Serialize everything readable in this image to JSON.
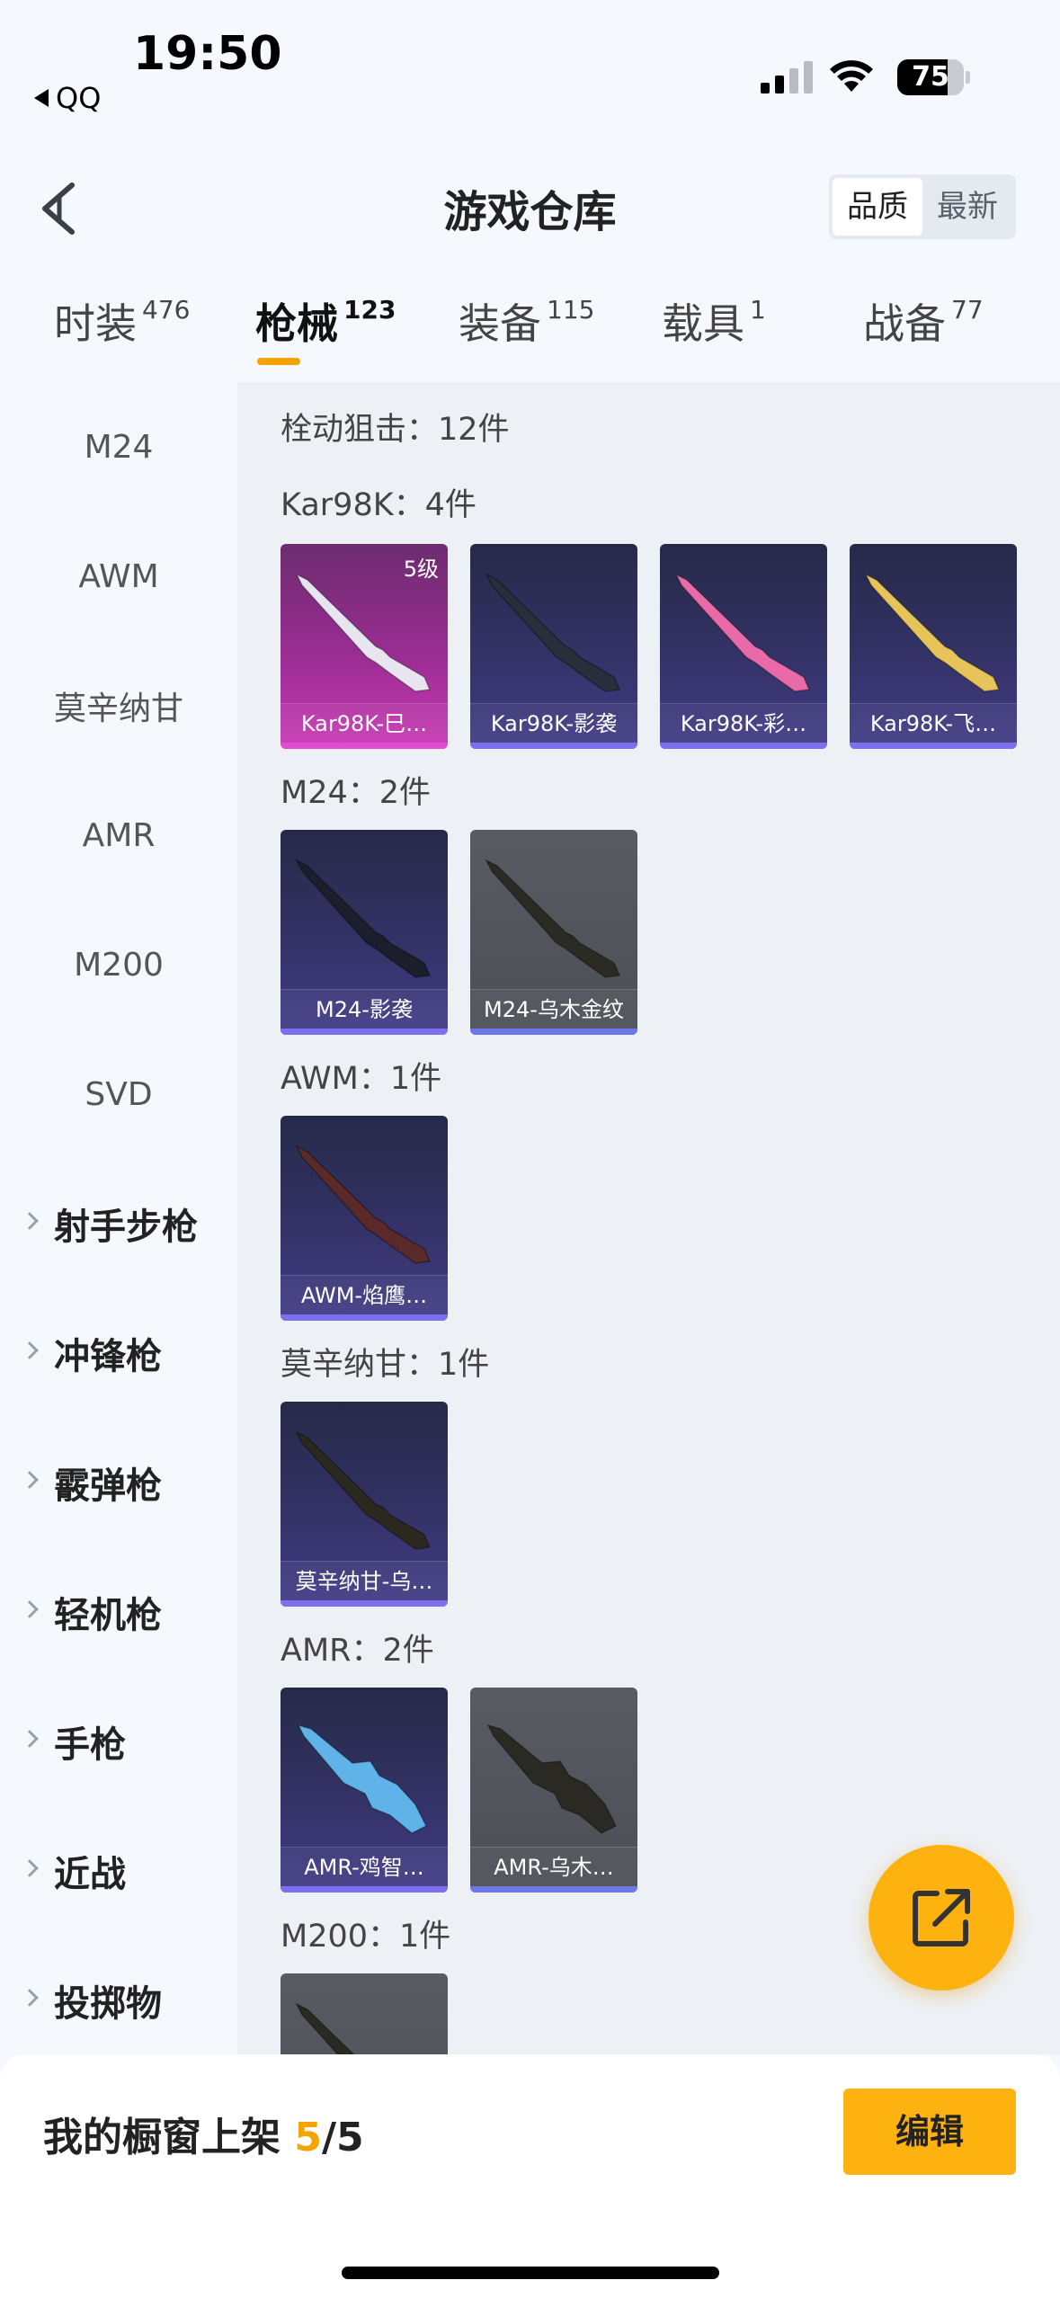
{
  "status_bar": {
    "time": "19:50",
    "back_app": "QQ",
    "battery": "75",
    "battery_level": 0.75
  },
  "header": {
    "title": "游戏仓库",
    "sort_quality": "品质",
    "sort_latest": "最新"
  },
  "tabs": [
    {
      "label": "时装",
      "count": "476"
    },
    {
      "label": "枪械",
      "count": "123",
      "active": true
    },
    {
      "label": "装备",
      "count": "115"
    },
    {
      "label": "载具",
      "count": "1"
    },
    {
      "label": "战备",
      "count": "77"
    }
  ],
  "sidebar": {
    "items": [
      {
        "label": "M24"
      },
      {
        "label": "AWM"
      },
      {
        "label": "莫辛纳甘"
      },
      {
        "label": "AMR"
      },
      {
        "label": "M200"
      },
      {
        "label": "SVD"
      }
    ],
    "groups": [
      {
        "label": "射手步枪"
      },
      {
        "label": "冲锋枪"
      },
      {
        "label": "霰弹枪"
      },
      {
        "label": "轻机枪"
      },
      {
        "label": "手枪"
      },
      {
        "label": "近战"
      },
      {
        "label": "投掷物"
      }
    ]
  },
  "content": {
    "category_label": "栓动狙击：12件",
    "sections": [
      {
        "label": "Kar98K：4件",
        "items": [
          {
            "name": "Kar98K-巳…",
            "level": "5级",
            "style": "magenta",
            "gun_color": "#e8e4f0"
          },
          {
            "name": "Kar98K-影袭",
            "style": "purple",
            "gun_color": "#2a2d3a"
          },
          {
            "name": "Kar98K-彩…",
            "style": "purple",
            "gun_color": "#e96aa8"
          },
          {
            "name": "Kar98K-飞…",
            "style": "purple",
            "gun_color": "#e7c45a"
          }
        ]
      },
      {
        "label": "M24：2件",
        "items": [
          {
            "name": "M24-影袭",
            "style": "purple",
            "gun_color": "#1c1f2b"
          },
          {
            "name": "M24-乌木金纹",
            "style": "gray",
            "gun_color": "#2b2a24"
          }
        ]
      },
      {
        "label": "AWM：1件",
        "items": [
          {
            "name": "AWM-焰鹰…",
            "style": "purple",
            "gun_color": "#5a2a2a"
          }
        ]
      },
      {
        "label": "莫辛纳甘：1件",
        "items": [
          {
            "name": "莫辛纳甘-乌…",
            "style": "purple",
            "gun_color": "#2b2820"
          }
        ]
      },
      {
        "label": "AMR：2件",
        "items": [
          {
            "name": "AMR-鸡智…",
            "style": "purple",
            "gun_color": "#5fb3e8"
          },
          {
            "name": "AMR-乌木…",
            "style": "gray",
            "gun_color": "#2a2924"
          }
        ]
      },
      {
        "label": "M200：1件",
        "items": [
          {
            "name": "",
            "style": "gray",
            "gun_color": "#2a2924"
          }
        ]
      }
    ]
  },
  "bottom": {
    "showcase_prefix": "我的橱窗上架 ",
    "showcase_current": "5",
    "showcase_total": "/5",
    "edit_label": "编辑"
  }
}
